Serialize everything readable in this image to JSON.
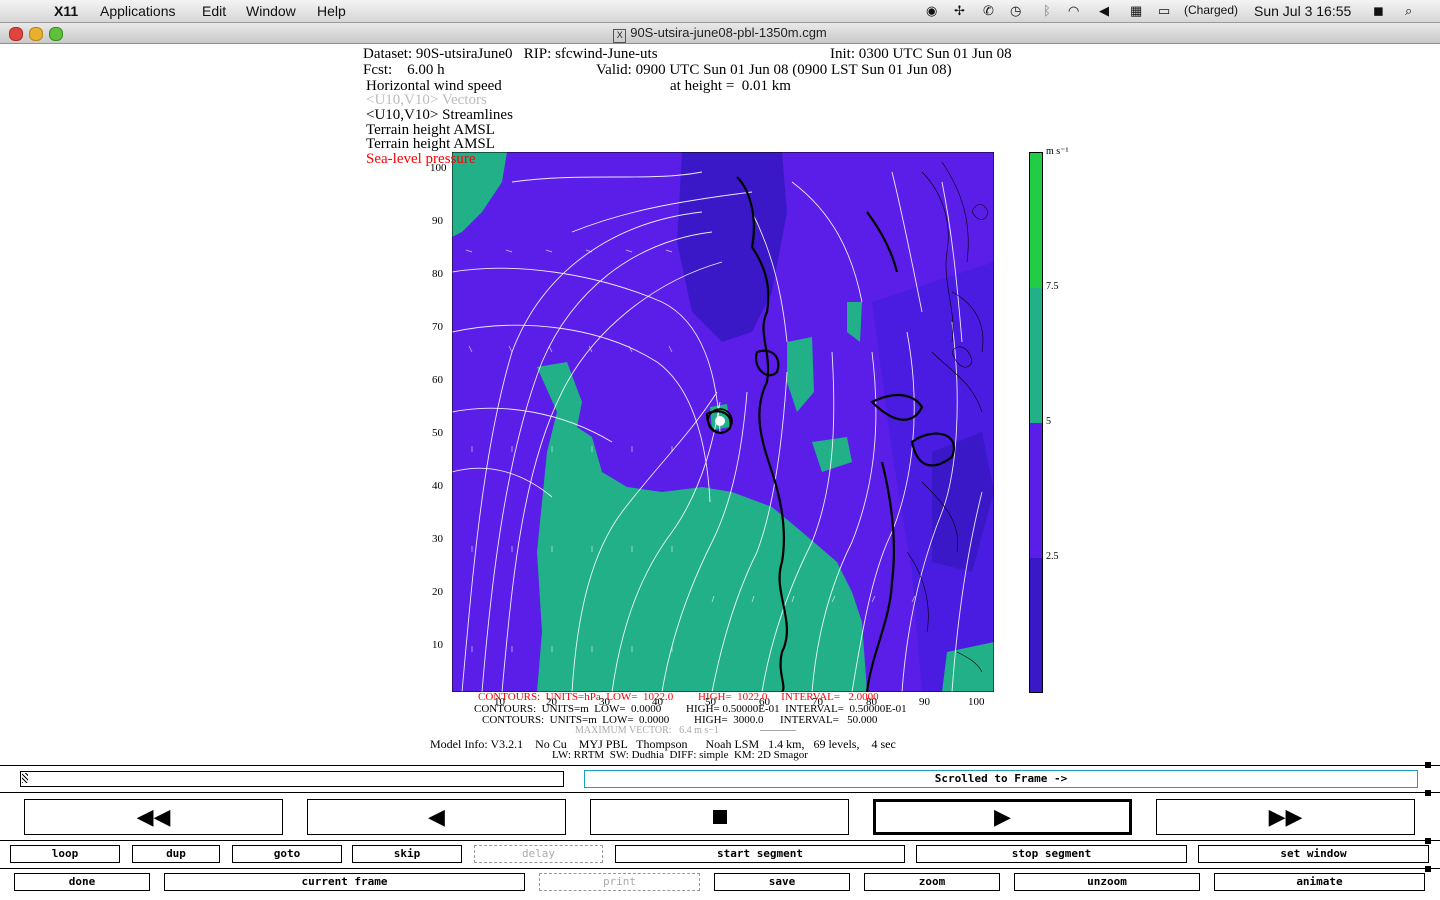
{
  "menubar": {
    "app": "X11",
    "items": [
      "Applications",
      "Edit",
      "Window",
      "Help"
    ],
    "battery": "(Charged)",
    "clock": "Sun Jul 3  16:55"
  },
  "window": {
    "title": "90S-utsira-june08-pbl-1350m.cgm"
  },
  "plot": {
    "dataset": "Dataset: 90S-utsiraJune0   RIP: sfcwind-June-uts",
    "init": "Init: 0300 UTC Sun 01 Jun 08",
    "fcst": "Fcst:    6.00 h",
    "valid": "Valid: 0900 UTC Sun 01 Jun 08 (0900 LST Sun 01 Jun 08)",
    "field1": "Horizontal wind speed",
    "height": "at height =  0.01 km",
    "field2": "<U10,V10> Vectors",
    "field3": "<U10,V10> Streamlines",
    "field4": "Terrain height AMSL",
    "field5": "Terrain height AMSL",
    "field6": "Sea-level pressure",
    "yticks": [
      "100",
      "90",
      "80",
      "70",
      "60",
      "50",
      "40",
      "30",
      "20",
      "10"
    ],
    "xticks": [
      "10",
      "20",
      "30",
      "40",
      "50",
      "60",
      "70",
      "80",
      "90",
      "100"
    ],
    "colorbar": {
      "units": "m s⁻¹",
      "labels": [
        "7.5",
        "5",
        "2.5"
      ],
      "colors": [
        "#22cc44",
        "#22b088",
        "#5b1ee8",
        "#3a18c8"
      ]
    },
    "contours": [
      "CONTOURS:  UNITS=hPa  LOW=  1022.0         HIGH=  1022.0     INTERVAL=   2.0000",
      "CONTOURS:  UNITS=m  LOW=  0.0000         HIGH= 0.50000E-01  INTERVAL=  0.50000E-01",
      "CONTOURS:  UNITS=m  LOW=  0.0000         HIGH=  3000.0      INTERVAL=   50.000"
    ],
    "max_vector": "MAXIMUM VECTOR:   6.4 m s−1",
    "model_info": "Model Info: V3.2.1    No Cu    MYJ PBL   Thompson      Noah LSM   1.4 km,   69 levels,    4 sec",
    "model_info2": "LW: RRTM  SW: Dudhia  DIFF: simple  KM: 2D Smagor"
  },
  "controls": {
    "status": "Scrolled to Frame ->",
    "transport": [
      "rewind",
      "step-back",
      "stop",
      "play",
      "fast-forward"
    ],
    "row1": [
      "loop",
      "dup",
      "goto",
      "skip",
      "delay",
      "start segment",
      "stop segment",
      "set window"
    ],
    "row2": [
      "done",
      "current frame",
      "print",
      "save",
      "zoom",
      "unzoom",
      "animate"
    ]
  }
}
